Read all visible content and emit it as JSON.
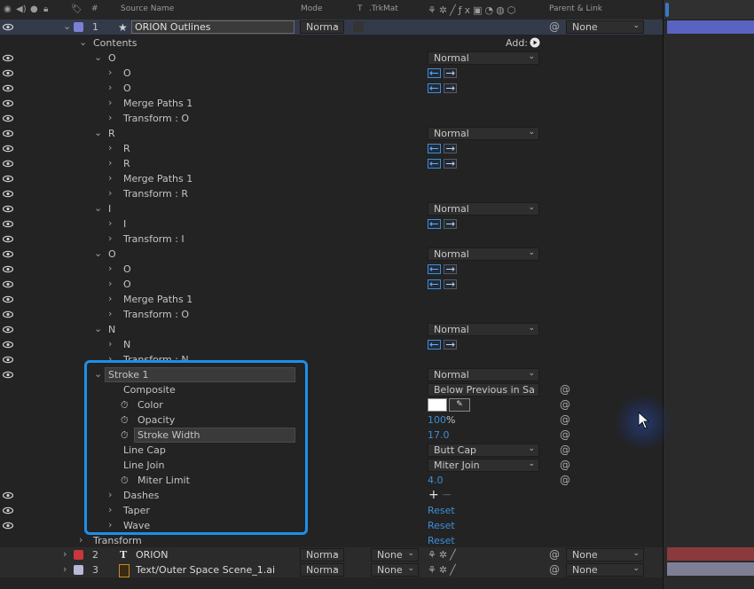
{
  "header": {
    "source_name": "Source Name",
    "mode": "Mode",
    "t": "T",
    "trkmat": ".TrkMat",
    "parent_link": "Parent & Link",
    "hash": "#"
  },
  "layer1": {
    "num": "1",
    "name": "ORION Outlines",
    "mode": "Norma",
    "parent": "None",
    "color": "#7b7fd6"
  },
  "contents_label": "Contents",
  "add_label": "Add:",
  "groups": [
    {
      "name": "O",
      "blend": "Normal",
      "children": [
        "O",
        "O",
        "Merge Paths 1",
        "Transform : O"
      ]
    },
    {
      "name": "R",
      "blend": "Normal",
      "children": [
        "R",
        "R",
        "Merge Paths 1",
        "Transform : R"
      ]
    },
    {
      "name": "I",
      "blend": "Normal",
      "children": [
        "I",
        "Transform : I"
      ]
    },
    {
      "name": "O",
      "blend": "Normal",
      "children": [
        "O",
        "O",
        "Merge Paths 1",
        "Transform : O"
      ]
    },
    {
      "name": "N",
      "blend": "Normal",
      "children": [
        "N",
        "Transform : N"
      ]
    }
  ],
  "stroke": {
    "name": "Stroke 1",
    "blend": "Normal",
    "composite_label": "Composite",
    "composite_value": "Below Previous in Sa",
    "color_label": "Color",
    "color_value": "#ffffff",
    "opacity_label": "Opacity",
    "opacity_value": "100",
    "opacity_unit": "%",
    "stroke_width_label": "Stroke Width",
    "stroke_width_value": "17.0",
    "line_cap_label": "Line Cap",
    "line_cap_value": "Butt Cap",
    "line_join_label": "Line Join",
    "line_join_value": "Miter Join",
    "miter_limit_label": "Miter Limit",
    "miter_limit_value": "4.0",
    "dashes_label": "Dashes",
    "taper_label": "Taper",
    "taper_value": "Reset",
    "wave_label": "Wave",
    "wave_value": "Reset"
  },
  "transform_label": "Transform",
  "transform_value": "Reset",
  "layer2": {
    "num": "2",
    "name": "ORION",
    "mode": "Norma",
    "trkmat": "None",
    "parent": "None",
    "color": "#c8373c",
    "type_glyph": "T"
  },
  "layer3": {
    "num": "3",
    "name": "Text/Outer Space Scene_1.ai",
    "mode": "Norma",
    "trkmat": "None",
    "parent": "None",
    "color": "#b8b8d8"
  },
  "colors": {
    "accent": "#1e8fe8",
    "value_blue": "#3d8ed8"
  }
}
